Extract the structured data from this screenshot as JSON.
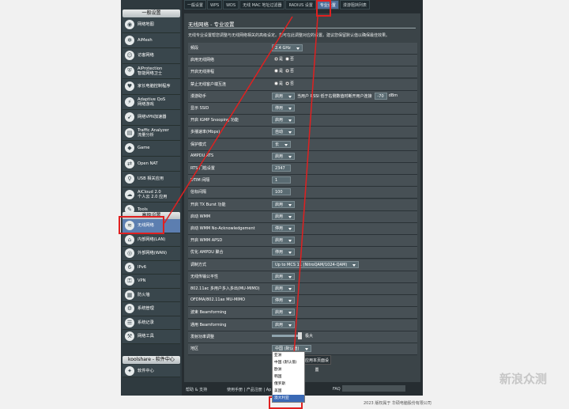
{
  "tabs": [
    {
      "label": "一般设置",
      "active": false
    },
    {
      "label": "WPS",
      "active": false
    },
    {
      "label": "WDS",
      "active": false
    },
    {
      "label": "无线 MAC 地址过滤器",
      "active": false
    },
    {
      "label": "RADIUS 设置",
      "active": false
    },
    {
      "label": "专业设置",
      "active": true
    },
    {
      "label": "漫游阻挡列表",
      "active": false
    }
  ],
  "sidebar": {
    "section_general": "一般设置",
    "items_general": [
      {
        "label": "网络地图",
        "icon": "network-map-icon"
      },
      {
        "label": "AiMesh",
        "icon": "aimesh-icon"
      },
      {
        "label": "访客网络",
        "icon": "guest-network-icon"
      },
      {
        "label": "AiProtection\n智能网络卫士",
        "icon": "aiprotection-icon"
      },
      {
        "label": "家长电脑控制程序",
        "icon": "parental-control-icon"
      },
      {
        "label": "Adaptive QoS\n网络游戏",
        "icon": "qos-icon"
      },
      {
        "label": "网络VPN加速器",
        "icon": "vpn-accelerator-icon"
      },
      {
        "label": "Traffic Analyzer\n流量分析",
        "icon": "traffic-analyzer-icon"
      },
      {
        "label": "Game",
        "icon": "game-icon"
      },
      {
        "label": "Open NAT",
        "icon": "open-nat-icon"
      },
      {
        "label": "USB 相关应用",
        "icon": "usb-icon"
      },
      {
        "label": "AiCloud 2.0\n个人云 2.0 应用",
        "icon": "aicloud-icon"
      },
      {
        "label": "Tools",
        "icon": "tools-icon"
      }
    ],
    "section_advanced": "高级设置",
    "items_advanced": [
      {
        "label": "无线网络",
        "icon": "wireless-icon",
        "active": true
      },
      {
        "label": "内部网络(LAN)",
        "icon": "lan-icon"
      },
      {
        "label": "外部网络(WAN)",
        "icon": "wan-icon"
      },
      {
        "label": "IPv6",
        "icon": "ipv6-icon"
      },
      {
        "label": "VPN",
        "icon": "vpn-icon"
      },
      {
        "label": "防火墙",
        "icon": "firewall-icon"
      },
      {
        "label": "系统管理",
        "icon": "admin-icon"
      },
      {
        "label": "系统记录",
        "icon": "syslog-icon"
      },
      {
        "label": "网络工具",
        "icon": "network-tools-icon"
      }
    ],
    "section_koolshare": "koolshare - 软件中心",
    "items_koolshare": [
      {
        "label": "软件中心",
        "icon": "software-center-icon"
      }
    ]
  },
  "panel": {
    "title": "无线网络 - 专业设置",
    "description": "无线专业设置帮您调整与无线网络相关的高级设定。您可在此调整对应的设置。建议您保留默认值以确保最佳效果。",
    "rows": [
      {
        "label": "频段",
        "type": "select",
        "value": "2.4 GHz"
      },
      {
        "label": "启用无线网络",
        "type": "radio",
        "options": [
          "是",
          "否"
        ],
        "selected": 0
      },
      {
        "label": "开启无线排程",
        "type": "radio",
        "options": [
          "是",
          "否"
        ],
        "selected": 1
      },
      {
        "label": "禁止无线客户端互连",
        "type": "radio",
        "options": [
          "是",
          "否"
        ],
        "selected": 1
      },
      {
        "label": "漫游助手",
        "type": "select+text",
        "value": "启用",
        "text": "当用户 RSSI 低于右侧数值时断开用户连接",
        "input": "-70",
        "unit": "dBm"
      },
      {
        "label": "显示 SSID",
        "type": "select",
        "value": "停用"
      },
      {
        "label": "开启 IGMP Snooping 功能",
        "type": "select",
        "value": "启用"
      },
      {
        "label": "多播速率(Mbps)",
        "type": "select",
        "value": "自动"
      },
      {
        "label": "保护模式",
        "type": "select",
        "value": "长"
      },
      {
        "label": "AMPDU RTS",
        "type": "select",
        "value": "启用"
      },
      {
        "label": "RTS 门槛设置",
        "type": "input",
        "value": "2347"
      },
      {
        "label": "DTIM 间隔",
        "type": "input",
        "value": "1"
      },
      {
        "label": "信标间隔",
        "type": "input",
        "value": "100"
      },
      {
        "label": "开启 TX Burst 功能",
        "type": "select",
        "value": "启用"
      },
      {
        "label": "启动 WMM",
        "type": "select",
        "value": "启用"
      },
      {
        "label": "启动 WMM No-Acknowledgement",
        "type": "select",
        "value": "停用"
      },
      {
        "label": "开启 WMM APSD",
        "type": "select",
        "value": "启用"
      },
      {
        "label": "优化 AMPDU 聚合",
        "type": "select",
        "value": "停用"
      },
      {
        "label": "调制方式",
        "type": "select",
        "value": "Up to MCS 11 (NitroQAM/1024-QAM)"
      },
      {
        "label": "无线传输公平性",
        "type": "select",
        "value": "启用"
      },
      {
        "label": "802.11ac 多用户多入多出(MU-MIMO)",
        "type": "select",
        "value": "启用"
      },
      {
        "label": "OFDMA/802.11ax MU-MIMO",
        "type": "select",
        "value": "停用"
      },
      {
        "label": "波束 Beamforming",
        "type": "select",
        "value": "启用"
      },
      {
        "label": "通用 Beamforming",
        "type": "select",
        "value": "启用"
      },
      {
        "label": "发射功率调整",
        "type": "slider",
        "value": "极大"
      },
      {
        "label": "地区",
        "type": "select",
        "value": "中国 (默认值)"
      }
    ],
    "apply": "应用本页面设置"
  },
  "dropdown": [
    {
      "label": "亚洲",
      "selected": false
    },
    {
      "label": "中国 (默认值)",
      "selected": false
    },
    {
      "label": "欧洲",
      "selected": false
    },
    {
      "label": "韩国",
      "selected": false
    },
    {
      "label": "俄罗斯",
      "selected": false
    },
    {
      "label": "美国",
      "selected": false
    },
    {
      "label": "澳大利亚",
      "selected": true
    }
  ],
  "footer": {
    "help": "帮助 & 支持",
    "links": "使用手册 | 产品注册 | Ap",
    "faq": "FAQ"
  },
  "copyright": "2023 版权属于 华硕电脑股份有限公司",
  "watermark": "新浪众测",
  "colors": {
    "highlight_box": "#e02020",
    "active_nav": "#5c7eb0"
  }
}
